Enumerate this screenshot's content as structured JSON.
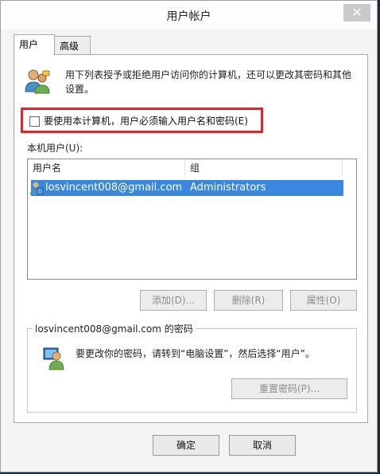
{
  "window": {
    "title": "用户帐户",
    "close_glyph": "✕"
  },
  "tabs": [
    {
      "label": "用户"
    },
    {
      "label": "高级"
    }
  ],
  "users_tab": {
    "description": "用下列表授予或拒绝用户访问你的计算机，还可以更改其密码和其他设置。",
    "require_login_checkbox": {
      "label": "要使用本计算机，用户必须输入用户名和密码(E)",
      "checked": false
    },
    "local_users_label": "本机用户(U):",
    "columns": [
      "用户名",
      "组"
    ],
    "rows": [
      {
        "username": "losvincent008@gmail.com",
        "group": "Administrators"
      }
    ],
    "buttons": {
      "add": "添加(D)...",
      "remove": "删除(R)",
      "properties": "属性(O)"
    },
    "password_group": {
      "title": "losvincent008@gmail.com 的密码",
      "description": "要更改你的密码，请转到“电脑设置”，然后选择“用户”。",
      "reset_button": "重置密码(P)..."
    }
  },
  "footer": {
    "ok": "确定",
    "cancel": "取消"
  },
  "colors": {
    "selection": "#3a87e0",
    "highlight_box": "#e3252b"
  }
}
